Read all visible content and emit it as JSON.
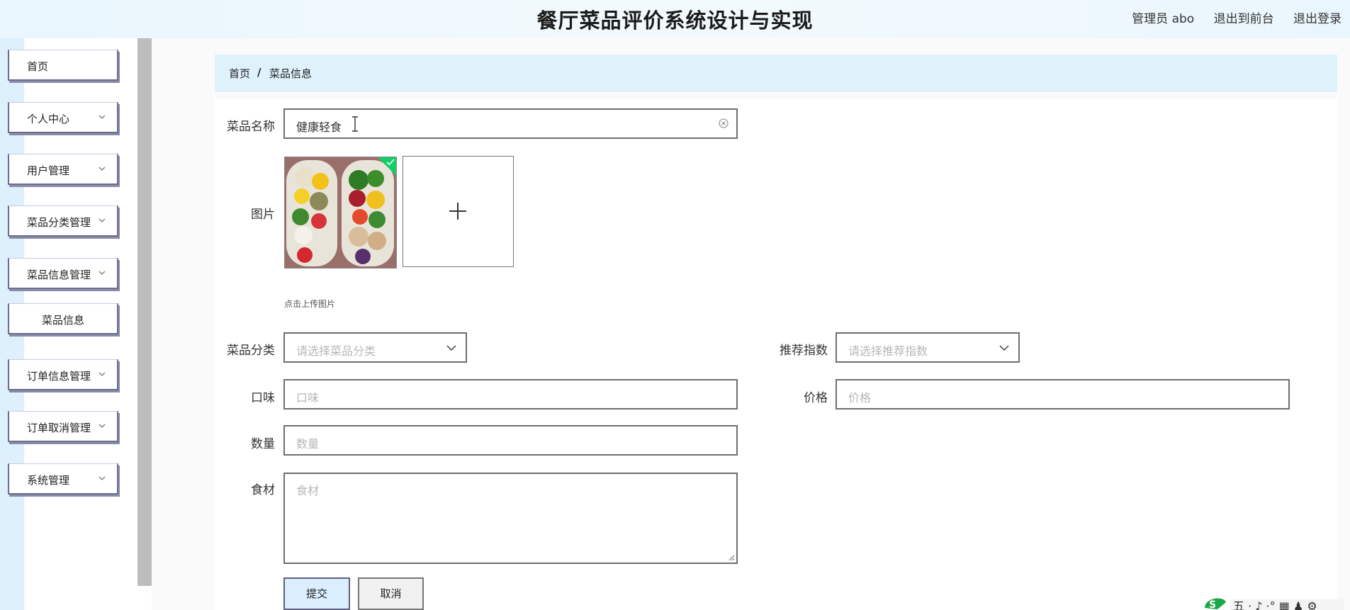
{
  "header": {
    "title": "餐厅菜品评价系统设计与实现",
    "admin_label": "管理员 abo",
    "back_front": "退出到前台",
    "logout": "退出登录"
  },
  "sidebar": {
    "items": [
      {
        "label": "首页",
        "has_chevron": false
      },
      {
        "label": "个人中心",
        "has_chevron": true
      },
      {
        "label": "用户管理",
        "has_chevron": true
      },
      {
        "label": "菜品分类管理",
        "has_chevron": true
      },
      {
        "label": "菜品信息管理",
        "has_chevron": true
      },
      {
        "label": "菜品信息",
        "has_chevron": false
      },
      {
        "label": "订单信息管理",
        "has_chevron": true
      },
      {
        "label": "订单取消管理",
        "has_chevron": true
      },
      {
        "label": "系统管理",
        "has_chevron": true
      }
    ]
  },
  "breadcrumb": {
    "home": "首页",
    "separator": "/",
    "current": "菜品信息"
  },
  "form": {
    "name": {
      "label": "菜品名称",
      "value": "健康轻食"
    },
    "image": {
      "label": "图片",
      "hint": "点击上传图片",
      "upload_icon": "plus-icon"
    },
    "category": {
      "label": "菜品分类",
      "placeholder": "请选择菜品分类"
    },
    "recommend": {
      "label": "推荐指数",
      "placeholder": "请选择推荐指数"
    },
    "taste": {
      "label": "口味",
      "placeholder": "口味"
    },
    "price": {
      "label": "价格",
      "placeholder": "价格"
    },
    "quantity": {
      "label": "数量",
      "placeholder": "数量"
    },
    "ingredients": {
      "label": "食材",
      "placeholder": "食材"
    },
    "submit": "提交",
    "cancel": "取消"
  },
  "colors": {
    "header_bg": "#e9f6fd",
    "breadcrumb_bg": "#dff1fb",
    "primary_button_bg": "#dbeefe",
    "upload_success": "#13ce66"
  }
}
